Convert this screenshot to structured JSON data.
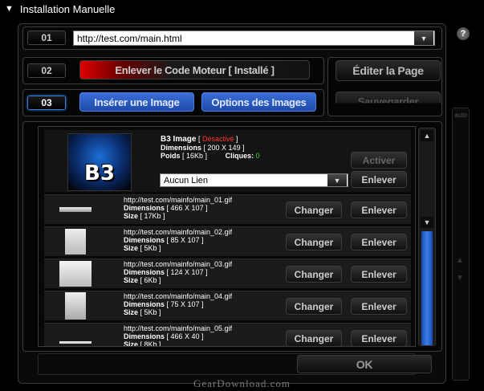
{
  "title": "Installation Manuelle",
  "step1": {
    "num": "01",
    "url": "http://test.com/main.html"
  },
  "step2": {
    "num": "02",
    "remove_code": "Enlever le Code Moteur [ Installé ]"
  },
  "step3": {
    "num": "03",
    "insert_image": "Insérer une Image",
    "image_options": "Options des Images"
  },
  "edit_page": "Éditer la Page",
  "save": "Sauvegarder",
  "sidebar_label": "auto",
  "selected": {
    "title": "B3 Image",
    "status": "Désactivé",
    "dim_label": "Dimensions",
    "dim_val": "[ 200 X 149 ]",
    "weight_label": "Poids",
    "weight_val": "[ 16Kb ]",
    "clicks_label": "Cliques:",
    "clicks_val": "0",
    "link": "Aucun Lien",
    "activate": "Activer",
    "remove": "Enlever",
    "thumb_text": "B3"
  },
  "row_labels": {
    "dimensions": "Dimensions",
    "size": "Size",
    "change": "Changer",
    "remove": "Enlever"
  },
  "rows": [
    {
      "url": "http://test.com/mainfo/main_01.gif",
      "dim": "[ 466 X 107 ]",
      "size": "[ 17Kb ]"
    },
    {
      "url": "http://test.com/mainfo/main_02.gif",
      "dim": "[ 85 X 107 ]",
      "size": "[ 5Kb ]"
    },
    {
      "url": "http://test.com/mainfo/main_03.gif",
      "dim": "[ 124 X 107 ]",
      "size": "[ 6Kb ]"
    },
    {
      "url": "http://test.com/mainfo/main_04.gif",
      "dim": "[ 75 X 107 ]",
      "size": "[ 5Kb ]"
    },
    {
      "url": "http://test.com/mainfo/main_05.gif",
      "dim": "[ 466 X 40 ]",
      "size": "[ 8Kb ]"
    }
  ],
  "ok": "OK",
  "watermark": "GearDownload.com",
  "colors": {
    "status_red": "#ff3333",
    "clicks_green": "#33dd33",
    "accent_blue": "#3a7ad8"
  }
}
